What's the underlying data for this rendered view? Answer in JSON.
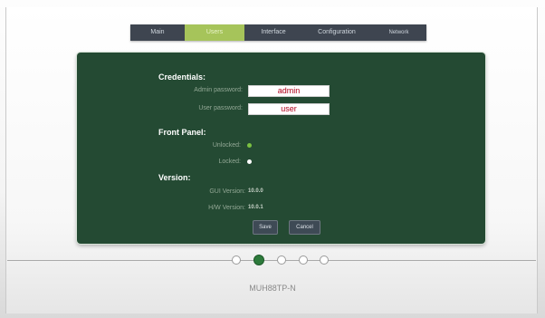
{
  "nav": {
    "items": [
      {
        "label": "Main",
        "active": false
      },
      {
        "label": "Users",
        "active": true
      },
      {
        "label": "Interface",
        "active": false
      },
      {
        "label": "Configuration",
        "active": false
      },
      {
        "label": "Network",
        "active": false
      }
    ]
  },
  "credentials": {
    "title": "Credentials:",
    "admin_label": "Admin password:",
    "admin_value": "admin",
    "user_label": "User password:",
    "user_value": "user"
  },
  "front_panel": {
    "title": "Front Panel:",
    "unlocked_label": "Unlocked:",
    "locked_label": "Locked:",
    "selected": "Unlocked"
  },
  "version": {
    "title": "Version:",
    "gui_label": "GUI  Version:",
    "gui_value": "10.0.0",
    "hw_label": "H/W  Version:",
    "hw_value": "10.0.1"
  },
  "buttons": {
    "save": "Save",
    "cancel": "Cancel"
  },
  "steps": {
    "count": 5,
    "active_index": 1
  },
  "model": "MUH88TP-N",
  "colors": {
    "panel": "#244a33",
    "nav": "#3e4550",
    "nav_active": "#a6c45a",
    "field_text": "#b0001a",
    "selected_dot": "#7bc142",
    "step_active": "#2d7a3b"
  }
}
